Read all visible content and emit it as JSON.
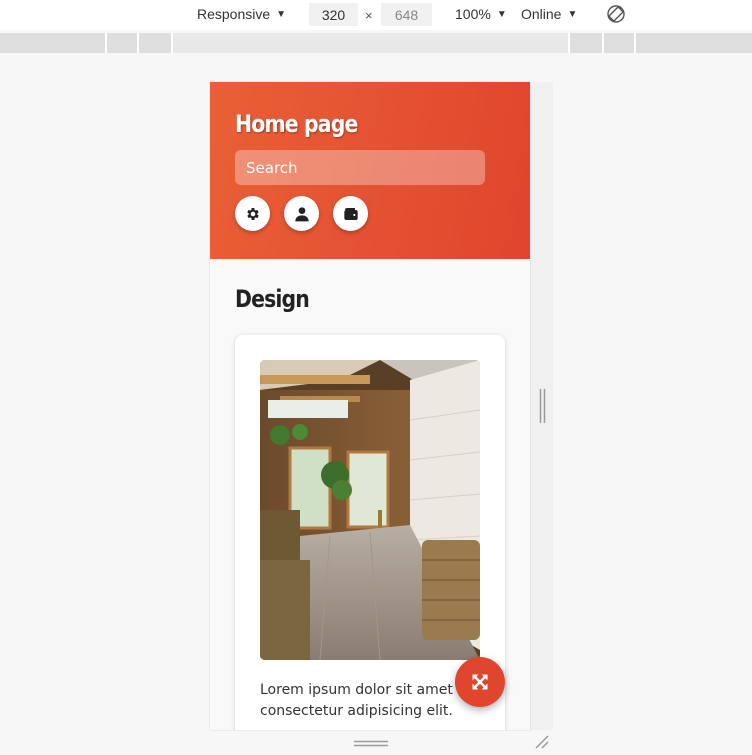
{
  "devtools": {
    "device_label": "Responsive",
    "width_value": "320",
    "height_value": "648",
    "times": "×",
    "zoom_label": "100%",
    "network_label": "Online"
  },
  "app": {
    "title": "Home page",
    "search_placeholder": "Search",
    "icons": [
      "gear-icon",
      "user-icon",
      "wallet-icon"
    ],
    "accent_color": "#e0452d"
  },
  "content": {
    "section_title": "Design",
    "card_text": "Lorem ipsum dolor sit amet consectetur adipisicing elit."
  }
}
